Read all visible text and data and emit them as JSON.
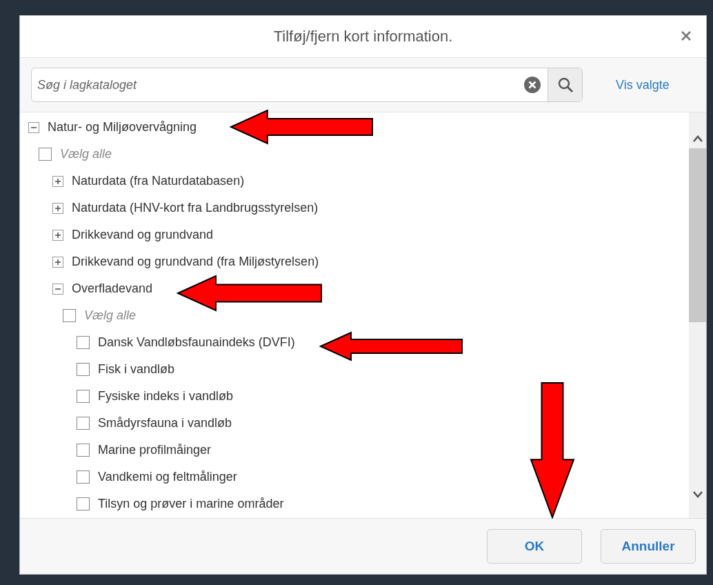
{
  "dialog": {
    "title": "Tilføj/fjern kort information."
  },
  "search": {
    "placeholder": "Søg i lagkataloget",
    "show_selected_link": "Vis valgte"
  },
  "tree": [
    {
      "kind": "group",
      "label": "Natur- og Miljøovervågning",
      "expanded": true,
      "children": [
        {
          "kind": "select-all",
          "label": "Vælg alle",
          "checked": false
        },
        {
          "kind": "group",
          "label": "Naturdata (fra Naturdatabasen)",
          "expanded": false
        },
        {
          "kind": "group",
          "label": "Naturdata (HNV-kort fra Landbrugsstyrelsen)",
          "expanded": false
        },
        {
          "kind": "group",
          "label": "Drikkevand og grundvand",
          "expanded": false
        },
        {
          "kind": "group",
          "label": "Drikkevand og grundvand (fra Miljøstyrelsen)",
          "expanded": false
        },
        {
          "kind": "group",
          "label": "Overfladevand",
          "expanded": true,
          "children": [
            {
              "kind": "select-all",
              "label": "Vælg alle",
              "checked": false
            },
            {
              "kind": "layer",
              "label": "Dansk Vandløbsfaunaindeks (DVFI)",
              "checked": false
            },
            {
              "kind": "layer",
              "label": "Fisk i vandløb",
              "checked": false
            },
            {
              "kind": "layer",
              "label": "Fysiske indeks i vandløb",
              "checked": false
            },
            {
              "kind": "layer",
              "label": "Smådyrsfauna i vandløb",
              "checked": false
            },
            {
              "kind": "layer",
              "label": "Marine profilmåinger",
              "checked": false
            },
            {
              "kind": "layer",
              "label": "Vandkemi og feltmålinger",
              "checked": false
            },
            {
              "kind": "layer",
              "label": "Tilsyn og prøver i marine områder",
              "checked": false
            }
          ]
        }
      ]
    }
  ],
  "buttons": [
    "OK",
    "Annuller"
  ]
}
